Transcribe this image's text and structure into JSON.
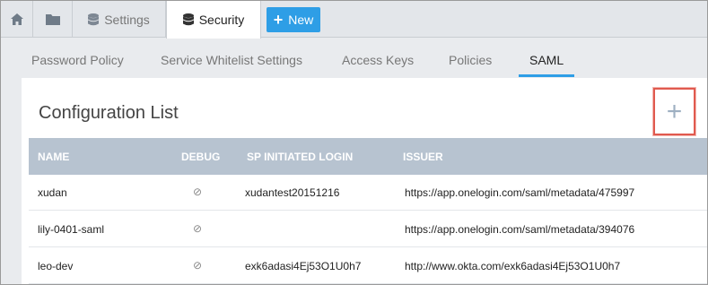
{
  "top_tabs": {
    "settings_label": "Settings",
    "security_label": "Security",
    "new_label": "New"
  },
  "sub_tabs": [
    {
      "label": "Password Policy"
    },
    {
      "label": "Service Whitelist Settings"
    },
    {
      "label": "Access Keys"
    },
    {
      "label": "Policies"
    },
    {
      "label": "SAML",
      "active": true
    }
  ],
  "panel": {
    "title": "Configuration List",
    "add_symbol": "+"
  },
  "table": {
    "columns": [
      "NAME",
      "DEBUG",
      "SP INITIATED LOGIN",
      "ISSUER"
    ],
    "rows": [
      {
        "name": "xudan",
        "debug": "⊘",
        "sp_login": "xudantest20151216",
        "issuer": "https://app.onelogin.com/saml/metadata/475997"
      },
      {
        "name": "lily-0401-saml",
        "debug": "⊘",
        "sp_login": "",
        "issuer": "https://app.onelogin.com/saml/metadata/394076"
      },
      {
        "name": "leo-dev",
        "debug": "⊘",
        "sp_login": "exk6adasi4Ej53O1U0h7",
        "issuer": "http://www.okta.com/exk6adasi4Ej53O1U0h7"
      }
    ]
  },
  "colors": {
    "accent": "#2e9ee6",
    "table_header": "#b7c3d0",
    "highlight_box": "#e05a4f"
  }
}
